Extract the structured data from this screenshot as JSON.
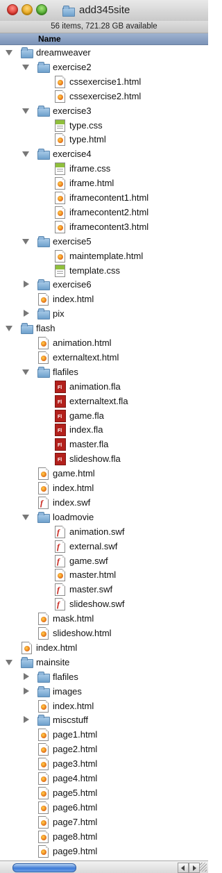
{
  "window": {
    "title": "add345site",
    "title_icon": "folder-icon"
  },
  "status": {
    "text": "56 items, 721.28 GB available"
  },
  "columns": {
    "name": "Name"
  },
  "tree": [
    {
      "label": "dreamweaver",
      "type": "folder",
      "expanded": true,
      "depth": 0
    },
    {
      "label": "exercise2",
      "type": "folder",
      "expanded": true,
      "depth": 1
    },
    {
      "label": "cssexercise1.html",
      "type": "html",
      "depth": 2
    },
    {
      "label": "cssexercise2.html",
      "type": "html",
      "depth": 2
    },
    {
      "label": "exercise3",
      "type": "folder",
      "expanded": true,
      "depth": 1
    },
    {
      "label": "type.css",
      "type": "css",
      "depth": 2
    },
    {
      "label": "type.html",
      "type": "html",
      "depth": 2
    },
    {
      "label": "exercise4",
      "type": "folder",
      "expanded": true,
      "depth": 1
    },
    {
      "label": "iframe.css",
      "type": "css",
      "depth": 2
    },
    {
      "label": "iframe.html",
      "type": "html",
      "depth": 2
    },
    {
      "label": "iframecontent1.html",
      "type": "html",
      "depth": 2
    },
    {
      "label": "iframecontent2.html",
      "type": "html",
      "depth": 2
    },
    {
      "label": "iframecontent3.html",
      "type": "html",
      "depth": 2
    },
    {
      "label": "exercise5",
      "type": "folder",
      "expanded": true,
      "depth": 1
    },
    {
      "label": "maintemplate.html",
      "type": "html",
      "depth": 2
    },
    {
      "label": "template.css",
      "type": "css",
      "depth": 2
    },
    {
      "label": "exercise6",
      "type": "folder",
      "expanded": false,
      "depth": 1
    },
    {
      "label": "index.html",
      "type": "html",
      "depth": 1
    },
    {
      "label": "pix",
      "type": "folder",
      "expanded": false,
      "depth": 1
    },
    {
      "label": "flash",
      "type": "folder",
      "expanded": true,
      "depth": 0
    },
    {
      "label": "animation.html",
      "type": "html",
      "depth": 1
    },
    {
      "label": "externaltext.html",
      "type": "html",
      "depth": 1
    },
    {
      "label": "flafiles",
      "type": "folder",
      "expanded": true,
      "depth": 1
    },
    {
      "label": "animation.fla",
      "type": "fla",
      "depth": 2
    },
    {
      "label": "externaltext.fla",
      "type": "fla",
      "depth": 2
    },
    {
      "label": "game.fla",
      "type": "fla",
      "depth": 2
    },
    {
      "label": "index.fla",
      "type": "fla",
      "depth": 2
    },
    {
      "label": "master.fla",
      "type": "fla",
      "depth": 2
    },
    {
      "label": "slideshow.fla",
      "type": "fla",
      "depth": 2
    },
    {
      "label": "game.html",
      "type": "html",
      "depth": 1
    },
    {
      "label": "index.html",
      "type": "html",
      "depth": 1
    },
    {
      "label": "index.swf",
      "type": "swf",
      "depth": 1
    },
    {
      "label": "loadmovie",
      "type": "folder",
      "expanded": true,
      "depth": 1
    },
    {
      "label": "animation.swf",
      "type": "swf",
      "depth": 2
    },
    {
      "label": "external.swf",
      "type": "swf",
      "depth": 2
    },
    {
      "label": "game.swf",
      "type": "swf",
      "depth": 2
    },
    {
      "label": "master.html",
      "type": "html",
      "depth": 2
    },
    {
      "label": "master.swf",
      "type": "swf",
      "depth": 2
    },
    {
      "label": "slideshow.swf",
      "type": "swf",
      "depth": 2
    },
    {
      "label": "mask.html",
      "type": "html",
      "depth": 1
    },
    {
      "label": "slideshow.html",
      "type": "html",
      "depth": 1
    },
    {
      "label": "index.html",
      "type": "html",
      "depth": 0
    },
    {
      "label": "mainsite",
      "type": "folder",
      "expanded": true,
      "depth": 0
    },
    {
      "label": "flafiles",
      "type": "folder",
      "expanded": false,
      "depth": 1
    },
    {
      "label": "images",
      "type": "folder",
      "expanded": false,
      "depth": 1
    },
    {
      "label": "index.html",
      "type": "html",
      "depth": 1
    },
    {
      "label": "miscstuff",
      "type": "folder",
      "expanded": false,
      "depth": 1
    },
    {
      "label": "page1.html",
      "type": "html",
      "depth": 1
    },
    {
      "label": "page2.html",
      "type": "html",
      "depth": 1
    },
    {
      "label": "page3.html",
      "type": "html",
      "depth": 1
    },
    {
      "label": "page4.html",
      "type": "html",
      "depth": 1
    },
    {
      "label": "page5.html",
      "type": "html",
      "depth": 1
    },
    {
      "label": "page6.html",
      "type": "html",
      "depth": 1
    },
    {
      "label": "page7.html",
      "type": "html",
      "depth": 1
    },
    {
      "label": "page8.html",
      "type": "html",
      "depth": 1
    },
    {
      "label": "page9.html",
      "type": "html",
      "depth": 1
    }
  ]
}
